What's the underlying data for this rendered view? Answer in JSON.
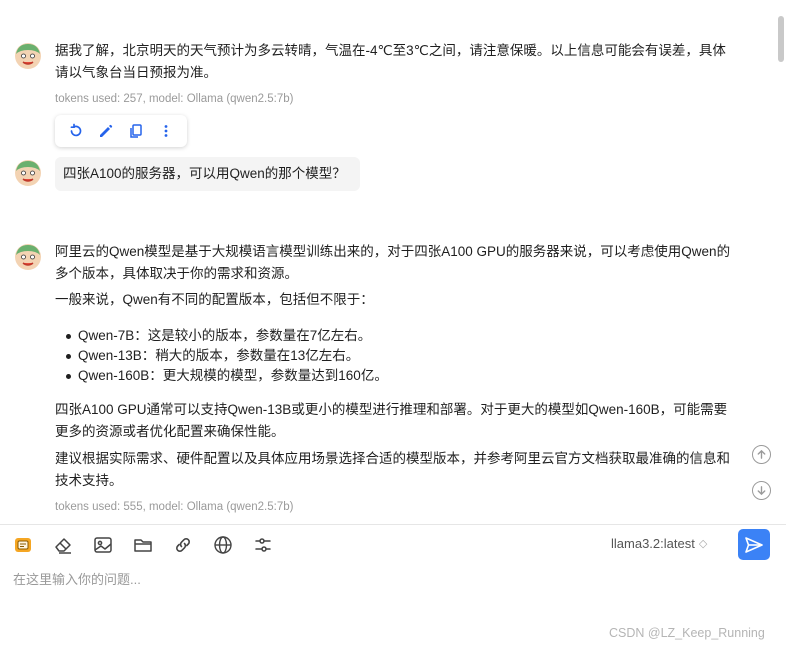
{
  "messages": {
    "first_answer": {
      "line1": "据我了解，北京明天的天气预计为多云转晴，气温在-4℃至3℃之间，请注意保暖。以上信息可能会有误差，具体",
      "line2": "请以气象台当日预报为准。",
      "meta": "tokens used: 257, model: Ollama (qwen2.5:7b)"
    },
    "question": "四张A100的服务器，可以用Qwen的那个模型？",
    "second_answer": {
      "p1_line1": "阿里云的Qwen模型是基于大规模语言模型训练出来的，对于四张A100 GPU的服务器来说，可以考虑使用Qwen的",
      "p1_line2": "多个版本，具体取决于你的需求和资源。",
      "p2": "一般来说，Qwen有不同的配置版本，包括但不限于：",
      "items": [
        "Qwen-7B：这是较小的版本，参数量在7亿左右。",
        "Qwen-13B：稍大的版本，参数量在13亿左右。",
        "Qwen-160B：更大规模的模型，参数量达到160亿。"
      ],
      "p3_line1": "四张A100 GPU通常可以支持Qwen-13B或更小的模型进行推理和部署。对于更大的模型如Qwen-160B，可能需要",
      "p3_line2": "更多的资源或者优化配置来确保性能。",
      "p4_line1": "建议根据实际需求、硬件配置以及具体应用场景选择合适的模型版本，并参考阿里云官方文档获取最准确的信息和",
      "p4_line2": "技术支持。",
      "meta": "tokens used: 555, model: Ollama (qwen2.5:7b)"
    }
  },
  "action_bar": {
    "icons": [
      "regenerate-icon",
      "edit-icon",
      "copy-icon",
      "more-icon"
    ]
  },
  "toolbar": {
    "icons": [
      "prompt-icon",
      "eraser-icon",
      "image-icon",
      "folder-icon",
      "link-icon",
      "globe-icon",
      "settings-sliders-icon"
    ]
  },
  "model_select": {
    "value": "llama3.2:latest"
  },
  "input": {
    "placeholder": "在这里输入你的问题..."
  },
  "watermark": "CSDN @LZ_Keep_Running",
  "colors": {
    "accent": "#3b82f6",
    "avatar_green": "#7cc47f",
    "icon_blue": "#2563eb"
  }
}
